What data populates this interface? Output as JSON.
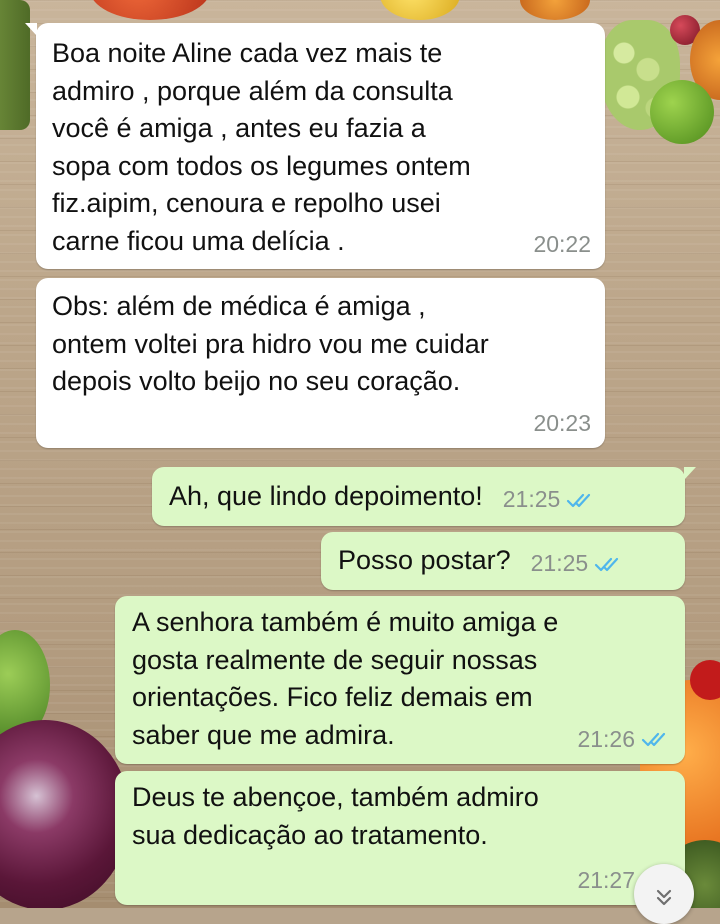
{
  "conversation": {
    "messages": [
      {
        "direction": "incoming",
        "text": "Boa noite Aline cada vez mais te\nadmiro , porque além  da consulta\nvocê é  amiga , antes eu fazia a\nsopa com todos os legumes ontem\nfiz.aipim, cenoura e repolho  usei\ncarne ficou uma delícia .",
        "time": "20:22"
      },
      {
        "direction": "incoming",
        "text": "Obs: além  de médica é  amiga ,\nontem voltei pra hidro vou me cuidar\ndepois volto beijo no seu coração.",
        "time": "20:23"
      },
      {
        "direction": "outgoing",
        "text": "Ah, que lindo depoimento!",
        "time": "21:25",
        "status": "read"
      },
      {
        "direction": "outgoing",
        "text": "Posso postar?",
        "time": "21:25",
        "status": "read"
      },
      {
        "direction": "outgoing",
        "text": "A senhora também é muito amiga e\ngosta realmente de seguir nossas\norientações. Fico feliz demais em\nsaber que me admira.",
        "time": "21:26",
        "status": "read"
      },
      {
        "direction": "outgoing",
        "text": "Deus te abençoe, também admiro\nsua dedicação ao tratamento.",
        "time": "21:27",
        "status": "read"
      }
    ]
  },
  "icons": {
    "read_receipt": "double-check-icon",
    "scroll_down": "chevron-double-down-icon"
  },
  "colors": {
    "incoming_bubble": "#ffffff",
    "outgoing_bubble": "#dcf8c6",
    "read_tick": "#4fb6ec",
    "timestamp": "#8a8f8c"
  }
}
